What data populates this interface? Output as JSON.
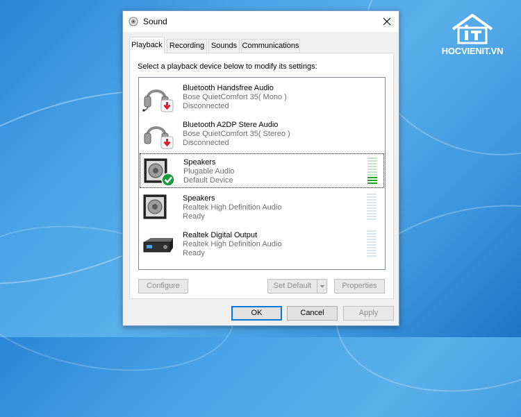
{
  "window": {
    "title": "Sound",
    "close_glyph": "✕"
  },
  "tabs": [
    {
      "label": "Playback",
      "active": true
    },
    {
      "label": "Recording",
      "active": false
    },
    {
      "label": "Sounds",
      "active": false
    },
    {
      "label": "Communications",
      "active": false
    }
  ],
  "playback": {
    "prompt": "Select a playback device below to modify its settings:",
    "devices": [
      {
        "name": "Bluetooth Handsfree Audio",
        "description": "Bose QuietComfort 35( Mono )",
        "status": "Disconnected",
        "icon": "headphones-icon",
        "badge": "disconnected-badge"
      },
      {
        "name": "Bluetooth A2DP Stere Audio",
        "description": "Bose QuietComfort 35( Stereo )",
        "status": "Disconnected",
        "icon": "headphones-icon",
        "badge": "disconnected-badge"
      },
      {
        "name": "Speakers",
        "description": "Plugable Audio",
        "status": "Default Device",
        "icon": "speaker-icon",
        "badge": "default-check-badge",
        "selected": true,
        "level_fraction": 0.3
      },
      {
        "name": "Speakers",
        "description": "Realtek High Definition Audio",
        "status": "Ready",
        "icon": "speaker-icon",
        "level_fraction": 0
      },
      {
        "name": "Realtek Digital Output",
        "description": "Realtek High Definition Audio",
        "status": "Ready",
        "icon": "digital-output-icon",
        "level_fraction": 0
      }
    ],
    "configure_label": "Configure",
    "set_default_label": "Set Default",
    "properties_label": "Properties"
  },
  "footer": {
    "ok_label": "OK",
    "cancel_label": "Cancel",
    "apply_label": "Apply"
  },
  "watermark": {
    "text": "HOCVIENIT.VN"
  },
  "colors": {
    "accent": "#0078d7",
    "meter_active": "#1ea31e",
    "disconnected_red": "#d9232d",
    "default_green": "#1a9a3a"
  }
}
